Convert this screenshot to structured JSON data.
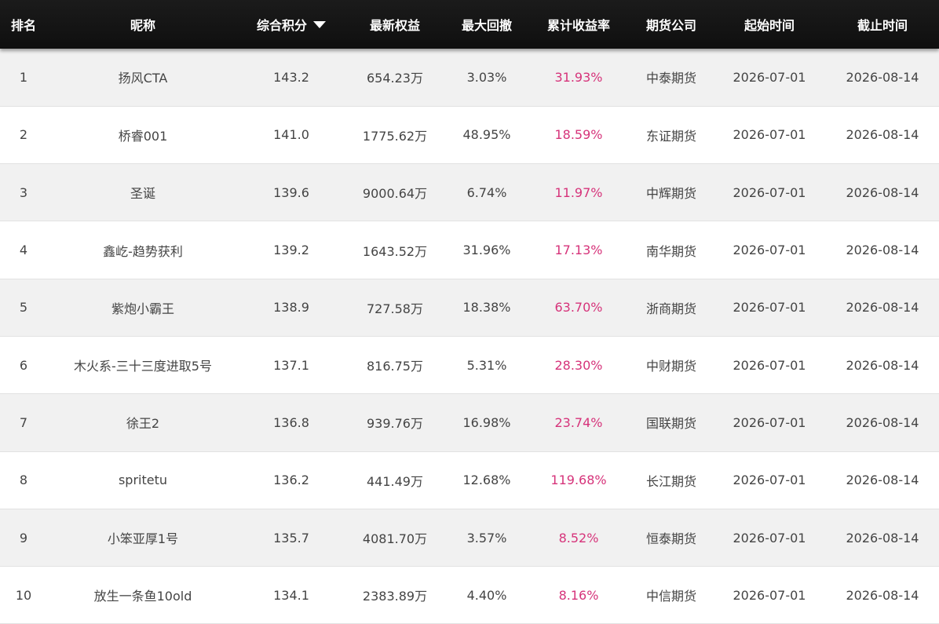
{
  "colors": {
    "header_bg": "#161616",
    "header_text": "#ffffff",
    "row_odd": "#f1f1f1",
    "row_even": "#ffffff",
    "return_text": "#d6337a",
    "body_text": "#444444"
  },
  "headers": {
    "rank": "排名",
    "nickname": "昵称",
    "score": "综合积分",
    "equity": "最新权益",
    "drawdown": "最大回撤",
    "return": "累计收益率",
    "company": "期货公司",
    "start": "起始时间",
    "end": "截止时间"
  },
  "sort_icon": "caret-down-icon",
  "rows": [
    {
      "rank": "1",
      "nickname": "扬风CTA",
      "score": "143.2",
      "equity": "654.23万",
      "drawdown": "3.03%",
      "return": "31.93%",
      "company": "中泰期货",
      "start": "2026-07-01",
      "end": "2026-08-14"
    },
    {
      "rank": "2",
      "nickname": "桥睿001",
      "score": "141.0",
      "equity": "1775.62万",
      "drawdown": "48.95%",
      "return": "18.59%",
      "company": "东证期货",
      "start": "2026-07-01",
      "end": "2026-08-14"
    },
    {
      "rank": "3",
      "nickname": "圣诞",
      "score": "139.6",
      "equity": "9000.64万",
      "drawdown": "6.74%",
      "return": "11.97%",
      "company": "中辉期货",
      "start": "2026-07-01",
      "end": "2026-08-14"
    },
    {
      "rank": "4",
      "nickname": "鑫屹-趋势获利",
      "score": "139.2",
      "equity": "1643.52万",
      "drawdown": "31.96%",
      "return": "17.13%",
      "company": "南华期货",
      "start": "2026-07-01",
      "end": "2026-08-14"
    },
    {
      "rank": "5",
      "nickname": "紫炮小霸王",
      "score": "138.9",
      "equity": "727.58万",
      "drawdown": "18.38%",
      "return": "63.70%",
      "company": "浙商期货",
      "start": "2026-07-01",
      "end": "2026-08-14"
    },
    {
      "rank": "6",
      "nickname": "木火系-三十三度进取5号",
      "score": "137.1",
      "equity": "816.75万",
      "drawdown": "5.31%",
      "return": "28.30%",
      "company": "中财期货",
      "start": "2026-07-01",
      "end": "2026-08-14"
    },
    {
      "rank": "7",
      "nickname": "徐王2",
      "score": "136.8",
      "equity": "939.76万",
      "drawdown": "16.98%",
      "return": "23.74%",
      "company": "国联期货",
      "start": "2026-07-01",
      "end": "2026-08-14"
    },
    {
      "rank": "8",
      "nickname": "spritetu",
      "score": "136.2",
      "equity": "441.49万",
      "drawdown": "12.68%",
      "return": "119.68%",
      "company": "长江期货",
      "start": "2026-07-01",
      "end": "2026-08-14"
    },
    {
      "rank": "9",
      "nickname": "小笨亚厚1号",
      "score": "135.7",
      "equity": "4081.70万",
      "drawdown": "3.57%",
      "return": "8.52%",
      "company": "恒泰期货",
      "start": "2026-07-01",
      "end": "2026-08-14"
    },
    {
      "rank": "10",
      "nickname": "放生一条鱼10old",
      "score": "134.1",
      "equity": "2383.89万",
      "drawdown": "4.40%",
      "return": "8.16%",
      "company": "中信期货",
      "start": "2026-07-01",
      "end": "2026-08-14"
    }
  ]
}
